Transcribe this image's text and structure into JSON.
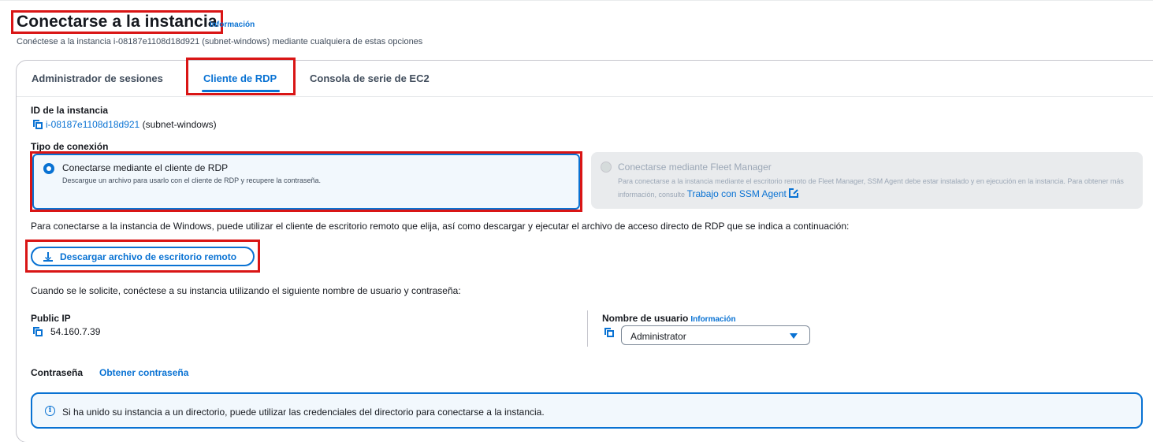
{
  "header": {
    "title": "Conectarse a la instancia",
    "info_link": "Información",
    "subtitle": "Conéctese a la instancia i-08187e1108d18d921 (subnet-windows) mediante cualquiera de estas opciones"
  },
  "tabs": [
    {
      "label": "Administrador de sesiones",
      "active": false
    },
    {
      "label": "Cliente de RDP",
      "active": true
    },
    {
      "label": "Consola de serie de EC2",
      "active": false
    }
  ],
  "instance": {
    "label": "ID de la instancia",
    "id": "i-08187e1108d18d921",
    "name": "(subnet-windows)"
  },
  "connection_type": {
    "label": "Tipo de conexión",
    "options": [
      {
        "title": "Conectarse mediante el cliente de RDP",
        "description": "Descargue un archivo para usarlo con el cliente de RDP y recupere la contraseña.",
        "selected": true,
        "disabled": false
      },
      {
        "title": "Conectarse mediante Fleet Manager",
        "description": "Para conectarse a la instancia mediante el escritorio remoto de Fleet Manager, SSM Agent debe estar instalado y en ejecución en la instancia. Para obtener más información, consulte",
        "link": "Trabajo con SSM Agent",
        "selected": false,
        "disabled": true
      }
    ]
  },
  "instructions": "Para conectarse a la instancia de Windows, puede utilizar el cliente de escritorio remoto que elija, así como descargar y ejecutar el archivo de acceso directo de RDP que se indica a continuación:",
  "download_button": "Descargar archivo de escritorio remoto",
  "prompt_text": "Cuando se le solicite, conéctese a su instancia utilizando el siguiente nombre de usuario y contraseña:",
  "public_ip": {
    "label": "Public IP",
    "value": "54.160.7.39"
  },
  "username": {
    "label": "Nombre de usuario",
    "info_link": "Información",
    "value": "Administrator"
  },
  "password": {
    "label": "Contraseña",
    "link": "Obtener contraseña"
  },
  "alert": {
    "text": "Si ha unido su instancia a un directorio, puede utilizar las credenciales del directorio para conectarse a la instancia."
  },
  "colors": {
    "accent": "#0972d3",
    "highlight_border": "#d91515",
    "selected_bg": "#f2f8fd"
  }
}
